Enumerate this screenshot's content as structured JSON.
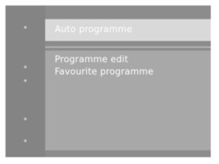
{
  "menu": {
    "selected_item": {
      "label": "Auto programme",
      "icon": "bullet-dot-icon"
    },
    "sub_items": [
      {
        "label": "Programme edit"
      },
      {
        "label": "Favourite programme"
      }
    ]
  },
  "colors": {
    "background": "#8c8c8c",
    "highlight": "#d9d9d9",
    "panel": "#a8a8a8",
    "text": "#ffffff"
  }
}
